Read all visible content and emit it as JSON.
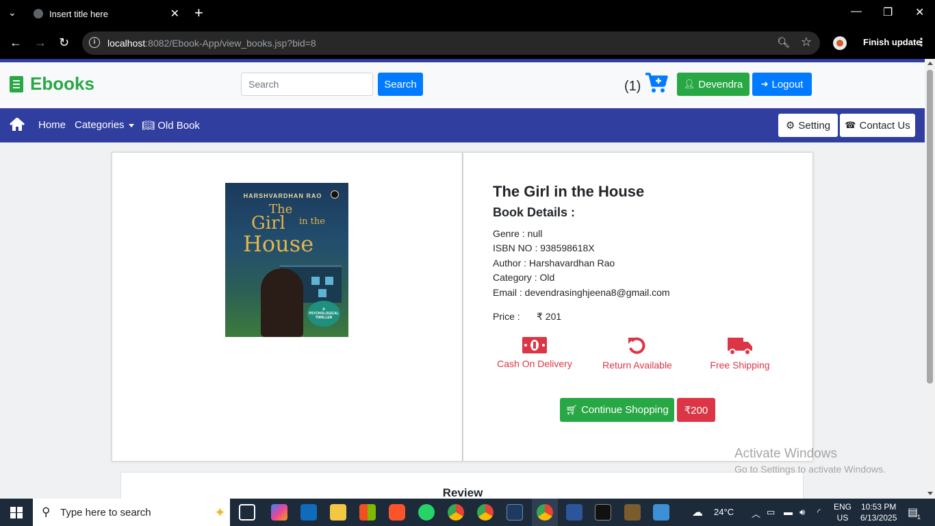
{
  "browser": {
    "tab_title": "Insert title here",
    "url_host": "localhost",
    "url_rest": ":8082/Ebook-App/view_books.jsp?bid=8",
    "update_label": "Finish update"
  },
  "header": {
    "brand": "Ebooks",
    "search_placeholder": "Search",
    "search_button": "Search",
    "cart_count": "(1)",
    "user_button": "Devendra",
    "logout_button": "Logout"
  },
  "navbar": {
    "home": "Home",
    "categories": "Categories",
    "old_book": "Old Book",
    "setting": "Setting",
    "contact": "Contact Us"
  },
  "book": {
    "cover_author": "HARSHVARDHAN RAO",
    "cover_title_1": "The",
    "cover_title_2": "Girl",
    "cover_title_3": "in the",
    "cover_title_4": "House",
    "cover_badge": "A PSYCHOLOGICAL THRILLER",
    "title": "The Girl in the House",
    "details_heading": "Book Details :",
    "genre": "Genre : null",
    "isbn": "ISBN NO : 938598618X",
    "author": "Author : Harshavardhan Rao",
    "category": "Category : Old",
    "email": "Email : devendrasinghjeena8@gmail.com",
    "price_label": "Price :",
    "price_value": "₹ 201"
  },
  "features": [
    {
      "label": "Cash On Delivery",
      "icon": "money-bill-icon"
    },
    {
      "label": "Return Available",
      "icon": "undo-icon"
    },
    {
      "label": "Free Shipping",
      "icon": "truck-icon"
    }
  ],
  "actions": {
    "continue_shopping": "Continue Shopping",
    "price_button": "₹200"
  },
  "review": {
    "heading": "Review"
  },
  "watermark": {
    "line1": "Activate Windows",
    "line2": "Go to Settings to activate Windows."
  },
  "taskbar": {
    "search_placeholder": "Type here to search",
    "weather": "24°C",
    "lang_1": "ENG",
    "lang_2": "US",
    "time": "10:53 PM",
    "date": "6/13/2025",
    "notification_count": "1"
  },
  "colors": {
    "brand_green": "#28a745",
    "primary_blue": "#007bff",
    "navbar_indigo": "#303f9f",
    "danger_red": "#dc3545"
  }
}
